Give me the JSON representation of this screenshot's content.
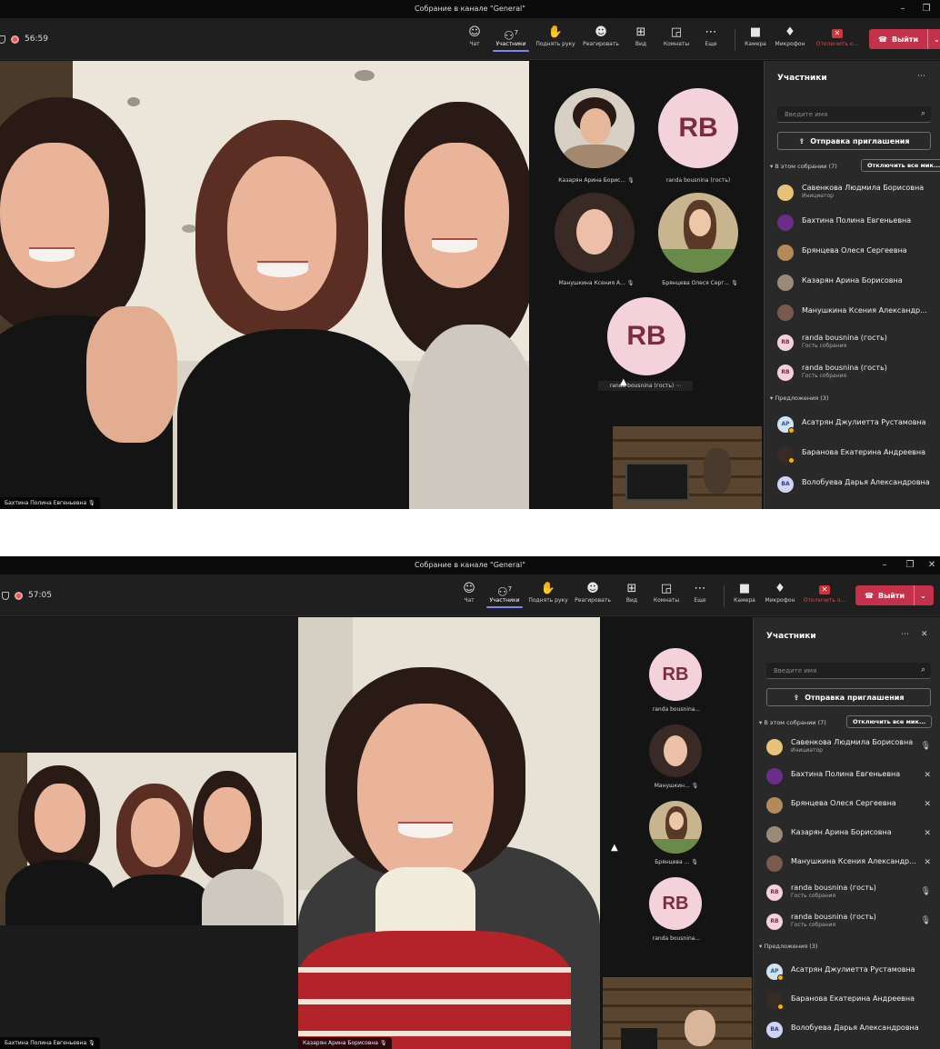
{
  "meeting": {
    "window_title": "Собрание в канале \"General\"",
    "colors": {
      "accent": "#7f85f5",
      "leave": "#c4314b",
      "recording": "#e0575a",
      "panel": "#292929"
    }
  },
  "toolbar": {
    "chat": "Чат",
    "participants": "Участники",
    "participants_count": "7",
    "raise_hand": "Поднять руку",
    "react": "Реагировать",
    "view": "Вид",
    "rooms": "Комнаты",
    "more": "Еще",
    "camera": "Камера",
    "mic": "Микрофон",
    "share_1": "Отключить о...",
    "share_2": "Отключить о...",
    "leave": "Выйти",
    "icons": [
      "chat-icon",
      "people-icon",
      "hand-icon",
      "smile-icon",
      "grid-icon",
      "rooms-icon",
      "more-icon",
      "camera-icon",
      "mic-icon",
      "share-stop-icon",
      "phone-icon"
    ]
  },
  "shot1": {
    "timer": "56:59",
    "main_video_name": "Бахтина Полина Евгеньевна",
    "gallery": [
      {
        "caption": "Казарян Арина Борис...",
        "initials": ""
      },
      {
        "caption": "randa bousnina (гость)",
        "initials": "RB"
      },
      {
        "caption": "Манушкина Ксения А...",
        "initials": ""
      },
      {
        "caption": "Брянцева Олеся Серг...",
        "initials": ""
      },
      {
        "caption": "randa bousnina (гость)",
        "initials": "RB"
      }
    ]
  },
  "shot2": {
    "timer": "57:05",
    "left_video_name": "Бахтина Полина Евгеньевна",
    "center_video_name": "Казарян Арина Борисовна",
    "gallery": [
      {
        "caption": "randa bousnina...",
        "initials": "RB"
      },
      {
        "caption": "Манушкин...",
        "initials": ""
      },
      {
        "caption": "Брянцева ...",
        "initials": ""
      },
      {
        "caption": "randa bousnina...",
        "initials": "RB"
      }
    ]
  },
  "panel": {
    "title": "Участники",
    "search_placeholder": "Введите имя",
    "invite": "Отправка приглашения",
    "in_meeting": "▾ В этом собрании (7)",
    "mute_all_1": "Отключить все мик...",
    "mute_all_2": "Отключить все мик...",
    "organizer_role": "Инициатор",
    "guest_role": "Гость собрания",
    "participants": [
      "Савенкова Людмила Борисовна",
      "Бахтина Полина Евгеньевна",
      "Брянцева Олеся Сергеевна",
      "Казарян Арина Борисовна",
      "Манушкина Ксения Александр...",
      "randa bousnina (гость)",
      "randa bousnina (гость)"
    ],
    "suggestions_header": "▾ Предложения (3)",
    "suggestions": [
      "Асатрян Джулиетта Рустамовна",
      "Баранова Екатерина Андреевна",
      "Волобуева Дарья Александровна"
    ],
    "suggestion_initials": [
      "АР",
      "",
      "ВА"
    ],
    "guest_initials": "RB"
  }
}
